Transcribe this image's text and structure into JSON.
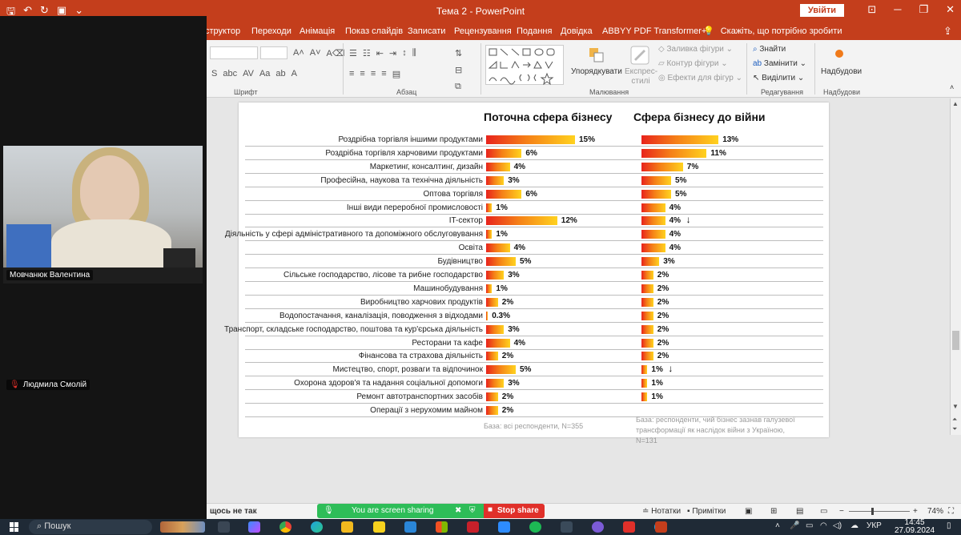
{
  "window": {
    "title": "Тема 2  -  PowerPoint",
    "signin_label": "Увійти",
    "qat_icons": [
      "save-icon",
      "undo-icon",
      "redo-icon",
      "present-icon",
      "more-icon"
    ]
  },
  "ribbon_tabs": [
    "структор",
    "Переходи",
    "Анімація",
    "Показ слайдів",
    "Записати",
    "Рецензування",
    "Подання",
    "Довідка",
    "ABBYY PDF Transformer+"
  ],
  "tell_me": "Скажіть, що потрібно зробити",
  "ribbon": {
    "groups": {
      "font": "Шрифт",
      "paragraph": "Абзац",
      "drawing": "Малювання",
      "editing": "Редагування",
      "addins": "Надбудови"
    },
    "arrange_label": "Упорядкувати",
    "quick_styles_label": "Експрес-стилі",
    "shape_fill": "Заливка фігури",
    "shape_outline": "Контур фігури",
    "shape_effects": "Ефекти для фігур",
    "find_label": "Знайти",
    "replace_label": "Замінити",
    "select_label": "Виділити",
    "addins_label": "Надбудови"
  },
  "chart_data": {
    "type": "bar",
    "categories": [
      "Роздрібна торгівля іншими продуктами",
      "Роздрібна торгівля харчовими продуктами",
      "Маркетинг, консалтинг, дизайн",
      "Професійна, наукова та технічна діяльність",
      "Оптова торгівля",
      "Інші види переробної промисловості",
      "IT-сектор",
      "Діяльність у сфері адміністративного та допоміжного обслуговування",
      "Освіта",
      "Будівництво",
      "Сільське господарство, лісове та рибне господарство",
      "Машинобудування",
      "Виробництво харчових продуктів",
      "Водопостачання, каналізація, поводження з відходами",
      "Транспорт, складське господарство, поштова та кур'єрська діяльність",
      "Ресторани та кафе",
      "Фінансова та страхова діяльність",
      "Мистецтво, спорт, розваги та відпочинок",
      "Охорона здоров'я та надання соціальної допомоги",
      "Ремонт автотранспортних засобів",
      "Операції з нерухомим майном"
    ],
    "series": [
      {
        "name": "Поточна сфера бізнесу",
        "values": [
          15,
          6,
          4,
          3,
          6,
          1,
          12,
          1,
          4,
          5,
          3,
          1,
          2,
          0.3,
          3,
          4,
          2,
          5,
          3,
          2,
          2
        ],
        "labels": [
          "15%",
          "6%",
          "4%",
          "3%",
          "6%",
          "1%",
          "12%",
          "1%",
          "4%",
          "5%",
          "3%",
          "1%",
          "2%",
          "0.3%",
          "3%",
          "4%",
          "2%",
          "5%",
          "3%",
          "2%",
          "2%"
        ],
        "note": "База: всі респонденти, N=355"
      },
      {
        "name": "Сфера бізнесу до війни",
        "values": [
          13,
          11,
          7,
          5,
          5,
          4,
          4,
          4,
          4,
          3,
          2,
          2,
          2,
          2,
          2,
          2,
          2,
          1,
          1,
          1,
          null
        ],
        "labels": [
          "13%",
          "11%",
          "7%",
          "5%",
          "5%",
          "4%",
          "4%",
          "4%",
          "4%",
          "3%",
          "2%",
          "2%",
          "2%",
          "2%",
          "2%",
          "2%",
          "2%",
          "1%",
          "1%",
          "1%",
          ""
        ],
        "arrows_down_at": [
          6,
          17
        ],
        "note": "База: респонденти, чий бізнес зазнав галузевої трансформації як наслідок війни з Україною, N=131"
      }
    ],
    "colors": {
      "gradient_start": "#e8231c",
      "gradient_mid": "#f57f17",
      "gradient_end": "#ffd21f"
    }
  },
  "status": {
    "left": "щось не так",
    "notes": "Нотатки",
    "comments": "Примітки",
    "zoom": "74%"
  },
  "share_bar": {
    "sharing_text": "You are screen sharing",
    "stop_label": "Stop share"
  },
  "participants": [
    {
      "name": "Мовчанюк Валентина",
      "muted": false
    },
    {
      "name": "Людмила Смолій",
      "muted": true
    }
  ],
  "taskbar": {
    "search_placeholder": "Пошук",
    "language": "УКР",
    "time": "14:45",
    "date": "27.09.2024"
  }
}
